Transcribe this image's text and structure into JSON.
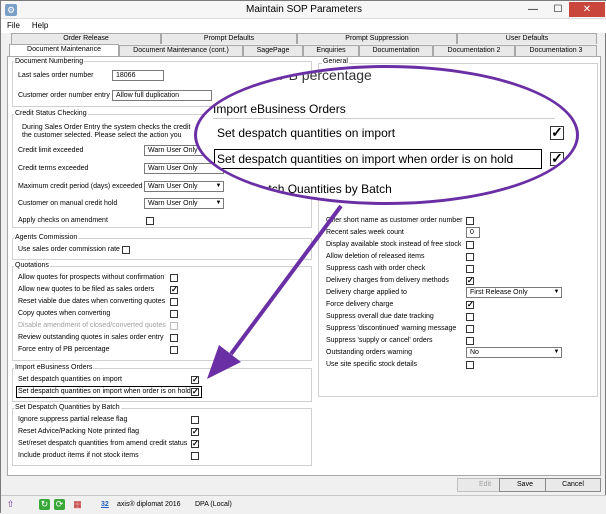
{
  "window": {
    "title": "Maintain SOP Parameters",
    "minimize": "—",
    "maximize": "☐",
    "close": "✕"
  },
  "menu": [
    "File",
    "Help"
  ],
  "tabs_row1": [
    "Order Release",
    "Prompt Defaults",
    "Prompt Suppression",
    "User Defaults"
  ],
  "tabs_row2": [
    "Document Maintenance",
    "Document Maintenance (cont.)",
    "SagePage",
    "Enquiries",
    "Documentation",
    "Documentation 2",
    "Documentation 3"
  ],
  "doc_numbering": {
    "title": "Document Numbering",
    "last_label": "Last sales order number",
    "last_value": "18066",
    "entry_label": "Customer order number entry",
    "entry_value": "Allow full duplication"
  },
  "credit": {
    "title": "Credit Status Checking",
    "desc1": "During Sales Order Entry the system checks the credit",
    "desc2": "the customer selected. Please select the action you",
    "rows": [
      {
        "label": "Credit limit exceeded",
        "value": "Warn User Only"
      },
      {
        "label": "Credit terms exceeded",
        "value": "Warn User Only"
      },
      {
        "label": "Maximum credit period (days) exceeded",
        "value": "Warn User Only"
      },
      {
        "label": "Customer on manual credit hold",
        "value": "Warn User Only"
      }
    ],
    "apply_label": "Apply checks on amendment"
  },
  "agents": {
    "title": "Agents Commission",
    "rate_label": "Use sales order commission rate"
  },
  "quotations": {
    "title": "Quotations",
    "items": [
      {
        "label": "Allow quotes for prospects without confirmation",
        "checked": "",
        "disabled": false
      },
      {
        "label": "Allow new quotes to be filed as sales orders",
        "checked": "✓",
        "disabled": false
      },
      {
        "label": "Reset viable due dates when converting quotes",
        "checked": "",
        "disabled": false
      },
      {
        "label": "Copy quotes when converting",
        "checked": "",
        "disabled": false
      },
      {
        "label": "Disable amendment of closed/converted quotes",
        "checked": "",
        "disabled": true
      },
      {
        "label": "Review outstanding quotes in sales order entry",
        "checked": "",
        "disabled": false
      },
      {
        "label": "Force entry of PB percentage",
        "checked": "",
        "disabled": false
      }
    ]
  },
  "ebusiness": {
    "title": "Import eBusiness Orders",
    "items": [
      {
        "label": "Set despatch quantities on import",
        "checked": "✓"
      },
      {
        "label": "Set despatch quantities on import when order is on hold",
        "checked": "✓"
      }
    ]
  },
  "batch": {
    "title": "Set Despatch Quantities by Batch",
    "items": [
      {
        "label": "Ignore suppress partial release flag",
        "checked": ""
      },
      {
        "label": "Reset Advice/Packing Note printed flag",
        "checked": "✓"
      },
      {
        "label": "Set/reset despatch quantities from amend credit status",
        "checked": "✓"
      },
      {
        "label": "Include product items if not stock items",
        "checked": ""
      }
    ]
  },
  "general": {
    "title": "General",
    "items": [
      {
        "label": "Offer short name as customer order number",
        "kind": "check",
        "value": ""
      },
      {
        "label": "Recent sales week count",
        "kind": "input",
        "value": "0"
      },
      {
        "label": "Display available stock instead of free stock",
        "kind": "check",
        "value": ""
      },
      {
        "label": "Allow deletion of released items",
        "kind": "check",
        "value": ""
      },
      {
        "label": "Suppress cash with order check",
        "kind": "check",
        "value": ""
      },
      {
        "label": "Delivery charges from delivery methods",
        "kind": "check",
        "value": "✓"
      },
      {
        "label": "Delivery charge applied to",
        "kind": "select",
        "value": "First Release Only"
      },
      {
        "label": "Force delivery charge",
        "kind": "check",
        "value": "✓"
      },
      {
        "label": "Suppress overall due date tracking",
        "kind": "check",
        "value": ""
      },
      {
        "label": "Suppress 'discontinued' warning message",
        "kind": "check",
        "value": ""
      },
      {
        "label": "Suppress 'supply or cancel' orders",
        "kind": "check",
        "value": ""
      },
      {
        "label": "Outstanding orders warning",
        "kind": "select",
        "value": "No"
      },
      {
        "label": "Use site specific stock details",
        "kind": "check",
        "value": ""
      }
    ]
  },
  "callout": {
    "partial_heading": "y or PB percentage",
    "heading": "Import eBusiness Orders",
    "row1": "Set despatch quantities on import",
    "row2": "Set despatch quantities on import when order is on hold",
    "checked": "✓",
    "footer": "t Despatch Quantities by Batch"
  },
  "buttons": {
    "edit": "Edit",
    "save": "Save",
    "cancel": "Cancel"
  },
  "status": {
    "count": "32",
    "product": "axis® diplomat 2016",
    "db": "DPA (Local)"
  }
}
